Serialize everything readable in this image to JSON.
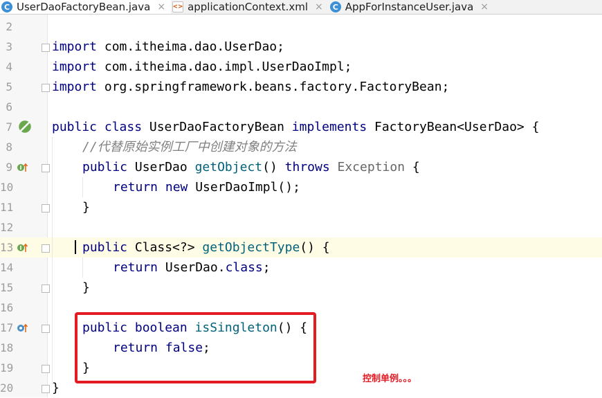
{
  "tabs": [
    {
      "icon": "C",
      "label": "UserDaoFactoryBean.java",
      "close": "×",
      "active": true
    },
    {
      "icon": "<>",
      "label": "applicationContext.xml",
      "close": "×",
      "active": false
    },
    {
      "icon": "C",
      "label": "AppForInstanceUser.java",
      "close": "×",
      "active": false
    }
  ],
  "lines": {
    "n2": "2",
    "n3": "3",
    "n4": "4",
    "n5": "5",
    "n6": "6",
    "n7": "7",
    "n8": "8",
    "n9": "9",
    "n10": "10",
    "n11": "11",
    "n12": "12",
    "n13": "13",
    "n14": "14",
    "n15": "15",
    "n16": "16",
    "n17": "17",
    "n18": "18",
    "n19": "19",
    "n20": "20"
  },
  "code": {
    "l3_kw": "import",
    "l3_rest": " com.itheima.dao.UserDao;",
    "l4_kw": "import",
    "l4_rest": " com.itheima.dao.impl.UserDaoImpl;",
    "l5_kw": "import",
    "l5_rest": " org.springframework.beans.factory.FactoryBean;",
    "l7_kw1": "public class",
    "l7_name": " UserDaoFactoryBean ",
    "l7_kw2": "implements",
    "l7_rest": " FactoryBean<UserDao> {",
    "l8_comment": "//代替原始实例工厂中创建对象的方法",
    "l9_kw": "public",
    "l9_type": " UserDao ",
    "l9_fn": "getObject",
    "l9_mid": "() ",
    "l9_kw2": "throws",
    "l9_exc": " Exception",
    "l9_end": " {",
    "l10_kw": "return new",
    "l10_rest": " UserDaoImpl();",
    "l11": "}",
    "l13_kw": "public",
    "l13_type": " Class<?> ",
    "l13_fn": "getObjectType",
    "l13_end": "() {",
    "l14_kw": "return",
    "l14_rest": " UserDao.",
    "l14_kw2": "class",
    "l14_end": ";",
    "l15": "}",
    "l17_kw": "public boolean",
    "l17_sp": " ",
    "l17_fn": "isSingleton",
    "l17_end": "() {",
    "l18_kw": "return false",
    "l18_end": ";",
    "l19": "}",
    "l20": "}"
  },
  "annotation": "控制单例。。。",
  "colors": {
    "keyword": "#000080",
    "method": "#00627a",
    "comment": "#808080",
    "highlight": "#e31b23"
  }
}
